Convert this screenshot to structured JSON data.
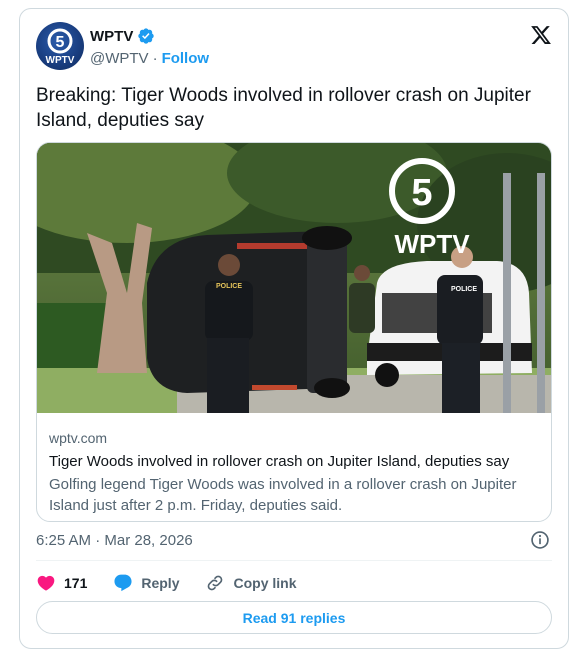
{
  "account": {
    "name": "WPTV",
    "handle": "@WPTV",
    "separator": "·",
    "follow_label": "Follow",
    "avatar_text": "WPTV",
    "avatar_number": "5"
  },
  "tweet": {
    "text": "Breaking: Tiger Woods involved in rollover crash on Jupiter Island, deputies say",
    "timestamp": "6:25 AM · Mar 28, 2026"
  },
  "link_card": {
    "domain": "wptv.com",
    "title": "Tiger Woods involved in rollover crash on Jupiter Island, deputies say",
    "description": "Golfing legend Tiger Woods was involved in a rollover crash on Jupiter Island just after 2 p.m. Friday, deputies said.",
    "watermark_text": "WPTV",
    "watermark_number": "5",
    "badge_police": "POLICE"
  },
  "actions": {
    "like_count": "171",
    "reply_label": "Reply",
    "copy_label": "Copy link",
    "read_replies_label": "Read 91 replies"
  },
  "colors": {
    "accent": "#1d9bf0",
    "like": "#f91880",
    "muted": "#536471",
    "border": "#cfd9de"
  },
  "icons": [
    "wptv-logo-icon",
    "verified-badge-icon",
    "x-logo-icon",
    "info-icon",
    "heart-icon",
    "reply-bubble-icon",
    "link-icon"
  ]
}
